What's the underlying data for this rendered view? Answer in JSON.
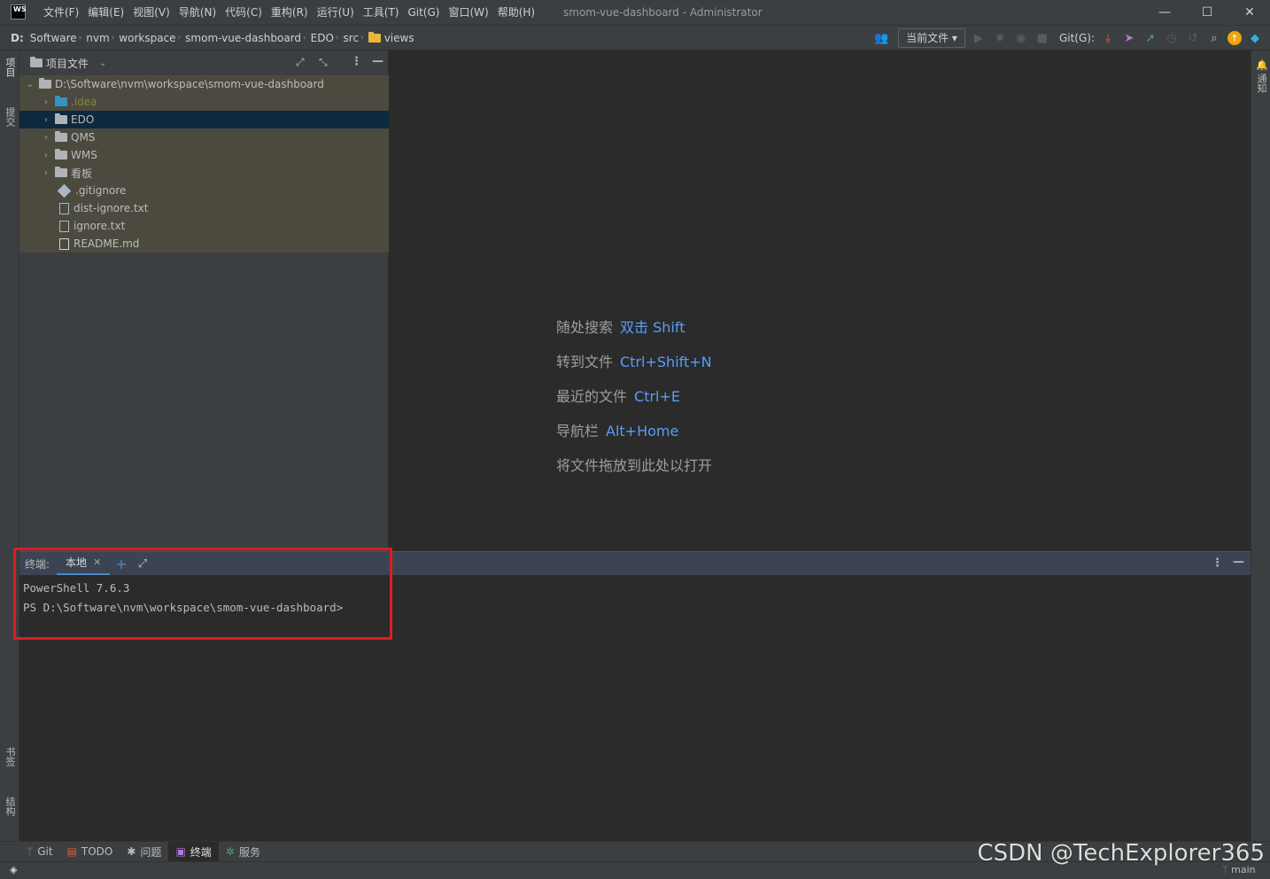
{
  "titlebar": {
    "logo": "WS",
    "menu": [
      "文件(F)",
      "编辑(E)",
      "视图(V)",
      "导航(N)",
      "代码(C)",
      "重构(R)",
      "运行(U)",
      "工具(T)",
      "Git(G)",
      "窗口(W)",
      "帮助(H)"
    ],
    "title": "smom-vue-dashboard - Administrator",
    "minimize": "—",
    "maximize": "☐",
    "close": "✕"
  },
  "navbar": {
    "breadcrumbs": [
      "D:",
      "Software",
      "nvm",
      "workspace",
      "smom-vue-dashboard",
      "EDO",
      "src",
      "views"
    ],
    "current_file": "当前文件",
    "git_label": "Git(G):"
  },
  "left_strip": {
    "project": "项目",
    "commit": "提交",
    "bookmarks": "书签",
    "structure": "结构"
  },
  "right_strip": {
    "notifications": "通知"
  },
  "project_panel": {
    "title": "项目文件",
    "root": "D:\\Software\\nvm\\workspace\\smom-vue-dashboard",
    "items": [
      {
        "name": ".idea",
        "type": "folder",
        "color": "#3592c4"
      },
      {
        "name": "EDO",
        "type": "folder"
      },
      {
        "name": "QMS",
        "type": "folder"
      },
      {
        "name": "WMS",
        "type": "folder"
      },
      {
        "name": "看板",
        "type": "folder"
      },
      {
        "name": ".gitignore",
        "type": "git"
      },
      {
        "name": "dist-ignore.txt",
        "type": "file"
      },
      {
        "name": "ignore.txt",
        "type": "file"
      },
      {
        "name": "README.md",
        "type": "md"
      }
    ]
  },
  "editor_hints": [
    {
      "label": "随处搜索",
      "key": "双击 Shift"
    },
    {
      "label": "转到文件",
      "key": "Ctrl+Shift+N"
    },
    {
      "label": "最近的文件",
      "key": "Ctrl+E"
    },
    {
      "label": "导航栏",
      "key": "Alt+Home"
    },
    {
      "label": "将文件拖放到此处以打开",
      "key": ""
    }
  ],
  "terminal": {
    "label": "终端:",
    "tab": "本地",
    "lines": [
      "PowerShell 7.6.3",
      "PS D:\\Software\\nvm\\workspace\\smom-vue-dashboard>"
    ]
  },
  "bottom_tabs": [
    "Git",
    "TODO",
    "问题",
    "终端",
    "服务"
  ],
  "status": {
    "branch": "main"
  },
  "watermark": "CSDN @TechExplorer365",
  "colors": {
    "accent": "#589df6",
    "highlight_box": "#e01b24",
    "selection": "#0d293e"
  }
}
